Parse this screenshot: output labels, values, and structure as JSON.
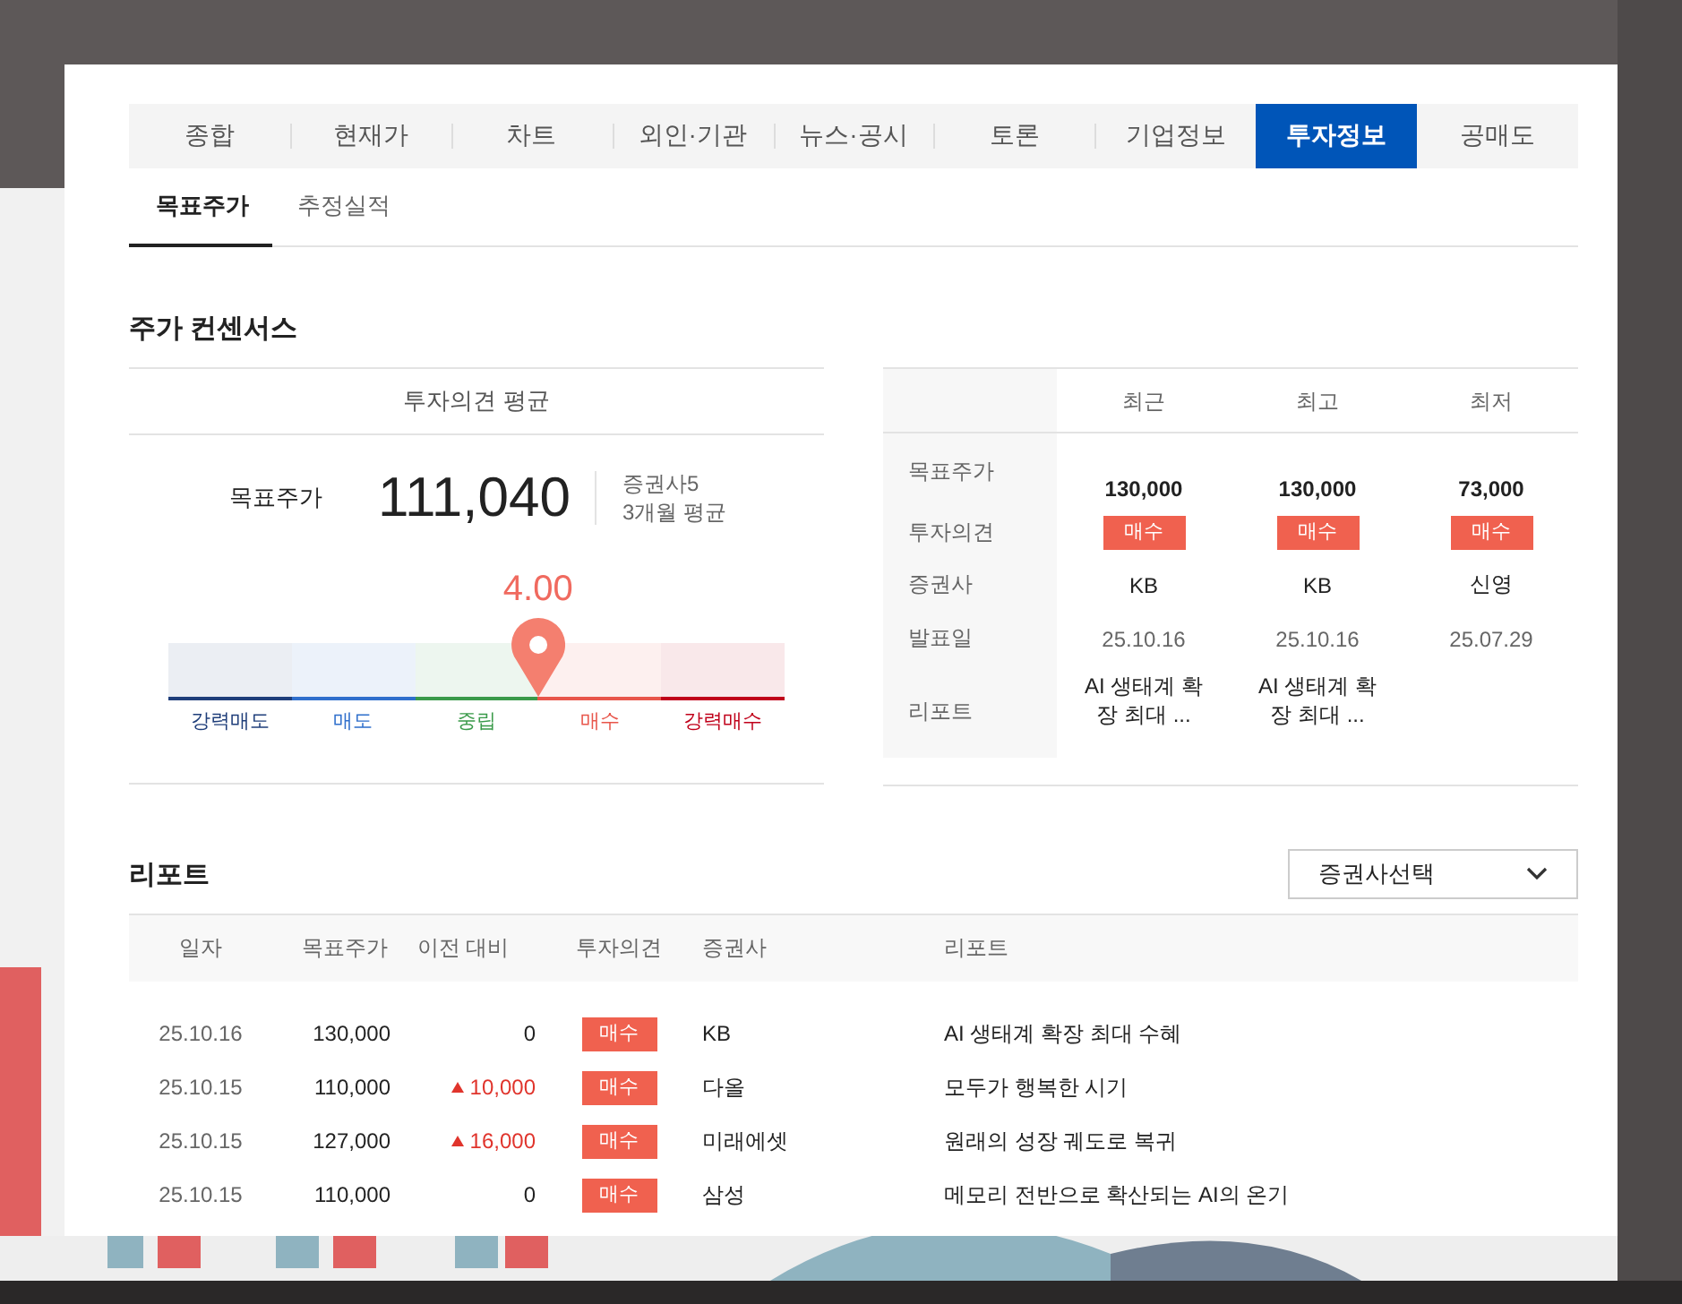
{
  "tabs": [
    {
      "label": "종합",
      "selected": false
    },
    {
      "label": "현재가",
      "selected": false
    },
    {
      "label": "차트",
      "selected": false
    },
    {
      "label": "외인·기관",
      "selected": false
    },
    {
      "label": "뉴스·공시",
      "selected": false
    },
    {
      "label": "토론",
      "selected": false
    },
    {
      "label": "기업정보",
      "selected": false
    },
    {
      "label": "투자정보",
      "selected": true
    },
    {
      "label": "공매도",
      "selected": false
    }
  ],
  "subtabs": [
    {
      "label": "목표주가",
      "selected": true
    },
    {
      "label": "추정실적",
      "selected": false
    }
  ],
  "consensus": {
    "title": "주가 컨센서스",
    "average": {
      "heading": "투자의견 평균",
      "label": "목표주가",
      "price": "111,040",
      "firms": "증권사5",
      "period": "3개월 평균",
      "score": "4.00",
      "level": 0.6,
      "segments": [
        {
          "label": "강력매도",
          "color": "#1f3e7a"
        },
        {
          "label": "매도",
          "color": "#2f6fcc"
        },
        {
          "label": "중립",
          "color": "#3a9a4a"
        },
        {
          "label": "매수",
          "color": "#e8564b"
        },
        {
          "label": "강력매수",
          "color": "#c0001a"
        }
      ]
    },
    "table": {
      "columns": [
        "최근",
        "최고",
        "최저"
      ],
      "rows": [
        {
          "label": "목표주가",
          "kind": "price",
          "cells": [
            "130,000",
            "130,000",
            "73,000"
          ]
        },
        {
          "label": "투자의견",
          "kind": "badge",
          "cells": [
            "매수",
            "매수",
            "매수"
          ]
        },
        {
          "label": "증권사",
          "kind": "firm",
          "cells": [
            "KB",
            "KB",
            "신영"
          ]
        },
        {
          "label": "발표일",
          "kind": "date",
          "cells": [
            "25.10.16",
            "25.10.16",
            "25.07.29"
          ]
        },
        {
          "label": "리포트",
          "kind": "report",
          "cells": [
            "AI 생태계 확장 최대 ...",
            "AI 생태계 확장 최대 ..."
          ]
        }
      ]
    }
  },
  "reports": {
    "title": "리포트",
    "dropdown": {
      "value": "증권사선택"
    },
    "columns": [
      "일자",
      "목표주가",
      "이전 대비",
      "투자의견",
      "증권사",
      "리포트"
    ],
    "rows": [
      {
        "date": "25.10.16",
        "target": "130,000",
        "change": "0",
        "kind": "flat",
        "opinion": "매수",
        "firm": "KB",
        "title": "AI 생태계 확장 최대 수혜"
      },
      {
        "date": "25.10.15",
        "target": "110,000",
        "change": "10,000",
        "kind": "up",
        "opinion": "매수",
        "firm": "다올",
        "title": "모두가 행복한 시기"
      },
      {
        "date": "25.10.15",
        "target": "127,000",
        "change": "16,000",
        "kind": "up",
        "opinion": "매수",
        "firm": "미래에셋",
        "title": "원래의 성장 궤도로 복귀"
      },
      {
        "date": "25.10.15",
        "target": "110,000",
        "change": "0",
        "kind": "flat",
        "opinion": "매수",
        "firm": "삼성",
        "title": "메모리 전반으로 확산되는 AI의 온기"
      }
    ]
  }
}
